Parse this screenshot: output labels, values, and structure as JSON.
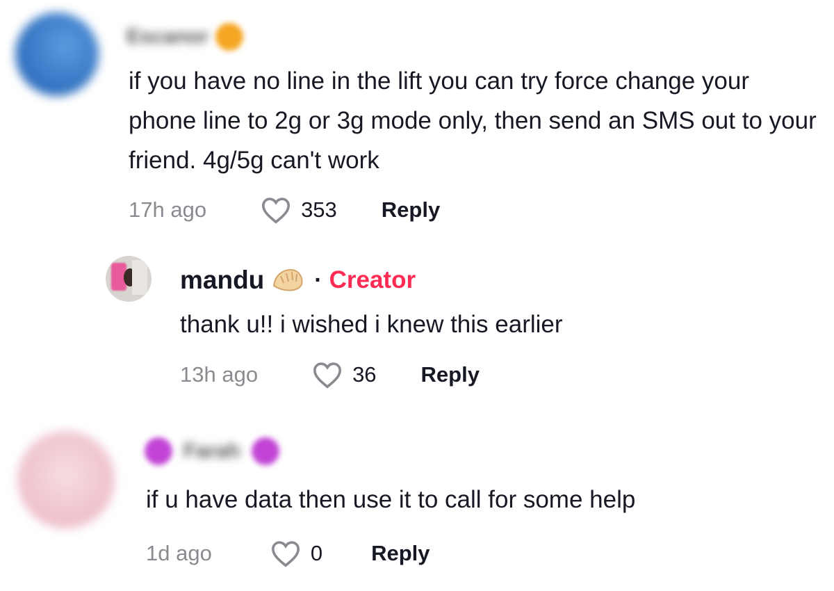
{
  "comments": [
    {
      "username": "Escanor",
      "text": "if you have no line in the lift you can try force change your phone line to 2g or 3g mode only, then send an SMS out to your friend. 4g/5g can't work",
      "time": "17h ago",
      "likes": "353",
      "reply_label": "Reply",
      "avatar_color": "#4f8fd6"
    },
    {
      "username": "mandu",
      "badge_separator": "·",
      "badge": "Creator",
      "badge_color": "#fe2c55",
      "text": "thank u!! i wished i knew this earlier",
      "time": "13h ago",
      "likes": "36",
      "reply_label": "Reply"
    },
    {
      "username": "Farah",
      "text": "if u have data then use it to call for some help",
      "time": "1d ago",
      "likes": "0",
      "reply_label": "Reply",
      "avatar_color": "#f3cfd8"
    }
  ]
}
